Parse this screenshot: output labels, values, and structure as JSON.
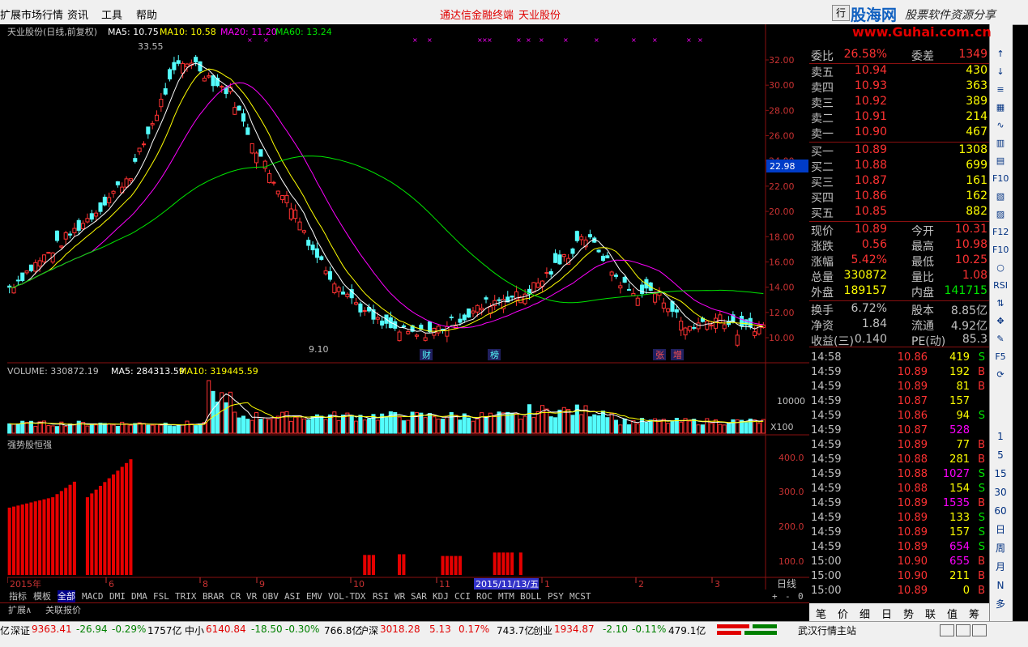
{
  "menu": {
    "items": [
      "扩展市场行情",
      "资讯",
      "工具",
      "帮助"
    ],
    "center1": "通达信金融终端",
    "center2": "天业股份",
    "right_btn": "行",
    "watermark": "股海网",
    "watermark_sub": "股票软件资源分享",
    "watermark_url": "www.Guhai.com.cn"
  },
  "chart": {
    "header": {
      "title": "天业股份(日线,前复权)",
      "ma5": "MA5: 10.75",
      "ma10": "MA10: 10.58",
      "ma20": "MA20: 11.20",
      "ma60": "MA60: 13.24"
    },
    "high_label": "33.55",
    "low_label": "9.10",
    "price_marker": "22.98",
    "y_ticks": [
      "32.00",
      "30.00",
      "28.00",
      "26.00",
      "24.00",
      "22.00",
      "20.00",
      "18.00",
      "16.00",
      "14.00",
      "12.00",
      "10.00"
    ],
    "events": [
      "财",
      "榜",
      "张",
      "增"
    ],
    "volume": {
      "label": "VOLUME: 330872.19",
      "ma5": "MA5: 284313.59",
      "ma10": "MA10: 319445.59",
      "tick": "10000",
      "unit": "X100"
    },
    "indicator": {
      "label": "强势股恒强",
      "ticks": [
        "400.0",
        "300.0",
        "200.0",
        "100.0"
      ]
    },
    "x_labels": [
      "2015年",
      "6",
      "8",
      "9",
      "10",
      "11",
      "1",
      "2",
      "3"
    ],
    "date_highlight": "2015/11/13/五",
    "period": "日线",
    "colors": {
      "up": "#ff3232",
      "down": "#54fcfc",
      "ma5": "#ffffff",
      "ma10": "#ffff00",
      "ma20": "#ff00ff",
      "ma60": "#00e600"
    }
  },
  "tabs_row1": [
    "指标",
    "模板",
    "全部",
    "MACD",
    "DMI",
    "DMA",
    "FSL",
    "TRIX",
    "BRAR",
    "CR",
    "VR",
    "OBV",
    "ASI",
    "EMV",
    "VOL-TDX",
    "RSI",
    "WR",
    "SAR",
    "KDJ",
    "CCI",
    "ROC",
    "MTM",
    "BOLL",
    "PSY",
    "MCST"
  ],
  "tabs_row2": [
    "扩展∧",
    "关联报价"
  ],
  "tab_ctrl": [
    "+",
    "-",
    "0"
  ],
  "quote": {
    "weibi": {
      "label": "委比",
      "value": "26.58%",
      "label2": "委差",
      "value2": "1349"
    },
    "sells": [
      [
        "卖五",
        "10.94",
        "430"
      ],
      [
        "卖四",
        "10.93",
        "363"
      ],
      [
        "卖三",
        "10.92",
        "389"
      ],
      [
        "卖二",
        "10.91",
        "214"
      ],
      [
        "卖一",
        "10.90",
        "467"
      ]
    ],
    "buys": [
      [
        "买一",
        "10.89",
        "1308"
      ],
      [
        "买二",
        "10.88",
        "699"
      ],
      [
        "买三",
        "10.87",
        "161"
      ],
      [
        "买四",
        "10.86",
        "162"
      ],
      [
        "买五",
        "10.85",
        "882"
      ]
    ],
    "stats": [
      [
        "现价",
        "10.89",
        "今开",
        "10.31"
      ],
      [
        "涨跌",
        "0.56",
        "最高",
        "10.98"
      ],
      [
        "涨幅",
        "5.42%",
        "最低",
        "10.25"
      ],
      [
        "总量",
        "330872",
        "量比",
        "1.08"
      ],
      [
        "外盘",
        "189157",
        "内盘",
        "141715"
      ]
    ],
    "fund": [
      [
        "换手",
        "6.72%",
        "股本",
        "8.85亿"
      ],
      [
        "净资",
        "1.84",
        "流通",
        "4.92亿"
      ],
      [
        "收益(三)",
        "0.140",
        "PE(动)",
        "85.3"
      ]
    ],
    "ticks": [
      [
        "14:58",
        "10.86",
        "419",
        "S"
      ],
      [
        "14:59",
        "10.89",
        "192",
        "B"
      ],
      [
        "14:59",
        "10.89",
        "81",
        "B"
      ],
      [
        "14:59",
        "10.87",
        "157",
        ""
      ],
      [
        "14:59",
        "10.86",
        "94",
        "S"
      ],
      [
        "14:59",
        "10.87",
        "528",
        ""
      ],
      [
        "14:59",
        "10.89",
        "77",
        "B"
      ],
      [
        "14:59",
        "10.88",
        "281",
        "B"
      ],
      [
        "14:59",
        "10.88",
        "1027",
        "S"
      ],
      [
        "14:59",
        "10.88",
        "154",
        "S"
      ],
      [
        "14:59",
        "10.89",
        "1535",
        "B"
      ],
      [
        "14:59",
        "10.89",
        "133",
        "S"
      ],
      [
        "14:59",
        "10.89",
        "157",
        "S"
      ],
      [
        "14:59",
        "10.89",
        "654",
        "S"
      ],
      [
        "15:00",
        "10.90",
        "655",
        "B"
      ],
      [
        "15:00",
        "10.90",
        "211",
        "B"
      ],
      [
        "15:00",
        "10.89",
        "0",
        "B"
      ]
    ]
  },
  "right_tabs": [
    "笔",
    "价",
    "细",
    "日",
    "势",
    "联",
    "值",
    "筹"
  ],
  "icons": [
    "up-arrow-icon",
    "down-arrow-icon",
    "list-icon",
    "grid-icon",
    "chart-icon",
    "candle-icon",
    "doc-icon",
    "f10-icon",
    "report-icon",
    "f11-icon",
    "f12-icon",
    "f10b-icon",
    "circle-icon",
    "rsi-icon",
    "sort-icon",
    "move-icon",
    "pen-icon",
    "f5-icon",
    "refresh-icon"
  ],
  "icon_text": [
    "↑",
    "↓",
    "≡",
    "▦",
    "∿",
    "▥",
    "▤",
    "F10",
    "▧",
    "▨",
    "F12",
    "F10",
    "○",
    "RSI",
    "⇅",
    "✥",
    "✎",
    "F5",
    "⟳"
  ],
  "period_btns": [
    "1",
    "5",
    "15",
    "30",
    "60",
    "日",
    "周",
    "月",
    "N",
    "多"
  ],
  "status": {
    "sz": "深证",
    "sz_val": "9363.41",
    "sz_chg": "-26.94",
    "sz_pct": "-0.29%",
    "sz_amt": "1757亿",
    "zx": "中小",
    "zx_val": "6140.84",
    "zx_chg": "-18.50",
    "zx_pct": "-0.30%",
    "zx_amt": "766.8亿",
    "hs": "沪深",
    "hs_val": "3018.28",
    "hs_chg": "5.13",
    "hs_pct": "0.17%",
    "hs_amt": "743.7亿",
    "cy": "创业",
    "cy_val": "1934.87",
    "cy_chg": "-2.10",
    "cy_pct": "-0.11%",
    "cy_amt": "479.1亿",
    "site": "武汉行情主站",
    "prefix": "亿"
  }
}
